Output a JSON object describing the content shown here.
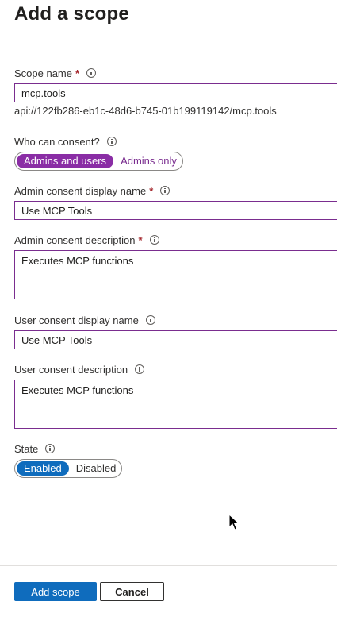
{
  "panel": {
    "title": "Add a scope"
  },
  "scope_name": {
    "label": "Scope name",
    "required_mark": "*",
    "value": "mcp.tools",
    "uri": "api://122fb286-eb1c-48d6-b745-01b199119142/mcp.tools"
  },
  "who_can_consent": {
    "label": "Who can consent?",
    "options": [
      "Admins and users",
      "Admins only"
    ],
    "selected": "Admins and users"
  },
  "admin_display_name": {
    "label": "Admin consent display name",
    "required_mark": "*",
    "value": "Use MCP Tools"
  },
  "admin_description": {
    "label": "Admin consent description",
    "required_mark": "*",
    "value": "Executes MCP functions"
  },
  "user_display_name": {
    "label": "User consent display name",
    "value": "Use MCP Tools"
  },
  "user_description": {
    "label": "User consent description",
    "value": "Executes MCP functions"
  },
  "state": {
    "label": "State",
    "options": [
      "Enabled",
      "Disabled"
    ],
    "selected": "Enabled"
  },
  "footer": {
    "primary_label": "Add scope",
    "secondary_label": "Cancel"
  },
  "colors": {
    "input_border": "#7a2d8f",
    "consent_accent": "#8a2da5",
    "primary_blue": "#0f6cbd",
    "required_red": "#a4262c"
  },
  "icons": {
    "info": "info-icon",
    "pointer": "mouse-cursor-icon"
  }
}
